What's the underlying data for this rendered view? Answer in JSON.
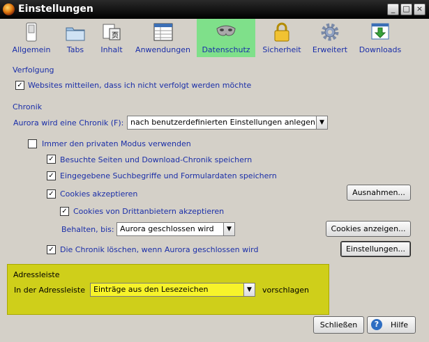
{
  "window": {
    "title": "Einstellungen",
    "buttons": [
      "_",
      "□",
      "×"
    ]
  },
  "toolbar": [
    {
      "label": "Allgemein",
      "icon": "switch-icon"
    },
    {
      "label": "Tabs",
      "icon": "folder-tabs-icon"
    },
    {
      "label": "Inhalt",
      "icon": "content-icon"
    },
    {
      "label": "Anwendungen",
      "icon": "applications-icon"
    },
    {
      "label": "Datenschutz",
      "icon": "mask-icon",
      "active": true
    },
    {
      "label": "Sicherheit",
      "icon": "lock-icon"
    },
    {
      "label": "Erweitert",
      "icon": "gear-icon"
    },
    {
      "label": "Downloads",
      "icon": "download-icon"
    }
  ],
  "tracking": {
    "heading": "Verfolgung",
    "dnt_label": "Websites mitteilen, dass ich nicht verfolgt werden möchte",
    "dnt_checked": true
  },
  "history": {
    "heading": "Chronik",
    "mode_label": "Aurora wird eine Chronik (F):",
    "mode_value": "nach benutzerdefinierten Einstellungen anlegen",
    "private_label": "Immer den privaten Modus verwenden",
    "private_checked": false,
    "visited_label": "Besuchte Seiten und Download-Chronik speichern",
    "search_label": "Eingegebene Suchbegriffe und Formulardaten speichern",
    "cookies_label": "Cookies akzeptieren",
    "exceptions_button": "Ausnahmen...",
    "third_party_label": "Cookies von Drittanbietern akzeptieren",
    "keep_label": "Behalten, bis:",
    "keep_value": "Aurora geschlossen wird",
    "show_cookies_button": "Cookies anzeigen...",
    "clear_label": "Die Chronik löschen, wenn Aurora geschlossen wird",
    "settings_button": "Einstellungen..."
  },
  "addressbar": {
    "heading": "Adressleiste",
    "prefix": "In der Adressleiste",
    "value": "Einträge aus den Lesezeichen",
    "suffix": "vorschlagen"
  },
  "footer": {
    "close_button": "Schließen",
    "help_button": "Hilfe",
    "help_icon_glyph": "?"
  },
  "colors": {
    "accent_text": "#1a2ea8",
    "active_tab": "#7fe08a",
    "highlight_panel": "#cfcf1a"
  }
}
